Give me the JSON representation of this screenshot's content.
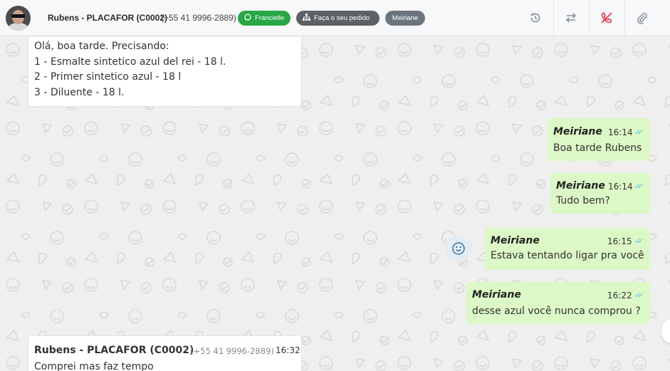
{
  "header": {
    "contact_name": "Rubens - PLACAFOR (C0002)",
    "contact_phone": "(+55 41 9996-2889)",
    "tags": [
      {
        "label": "Francielle",
        "icon": "whatsapp-icon",
        "color": "#28a745"
      },
      {
        "label": "Faça o seu pedido",
        "icon": "sitemap-icon",
        "color": "#5e6164"
      },
      {
        "label": "Meiriane",
        "icon": "",
        "color": "#6c757d"
      }
    ],
    "actions": [
      "history-icon",
      "transfer-icon",
      "hangup-phone-icon",
      "attach-icon"
    ]
  },
  "messages": {
    "incoming_first": {
      "lines": [
        "Olá, boa tarde. Precisando:",
        "1 - Esmalte sintetico azul del rei - 18 l.",
        "2 - Primer sintetico azul - 18 l",
        "3 - Diluente - 18 l."
      ]
    },
    "outgoing": [
      {
        "author": "Meiriane",
        "time": "16:14",
        "text": "Boa tarde Rubens"
      },
      {
        "author": "Meiriane",
        "time": "16:14",
        "text": "Tudo bem?"
      },
      {
        "author": "Meiriane",
        "time": "16:15",
        "text": "Estava tentando ligar pra você"
      },
      {
        "author": "Meiriane",
        "time": "16:22",
        "text": "desse azul você nunca comprou ?"
      }
    ],
    "incoming_last": {
      "name": "Rubens - PLACAFOR (C0002)",
      "phone": "(+55 41 9996-2889)",
      "time": "16:32",
      "preview": "Comprei mas faz tempo"
    }
  },
  "colors": {
    "outgoing_bubble": "#dcf8c6",
    "read_tick": "#4fc3f7",
    "hangup_red": "#dc3545"
  }
}
